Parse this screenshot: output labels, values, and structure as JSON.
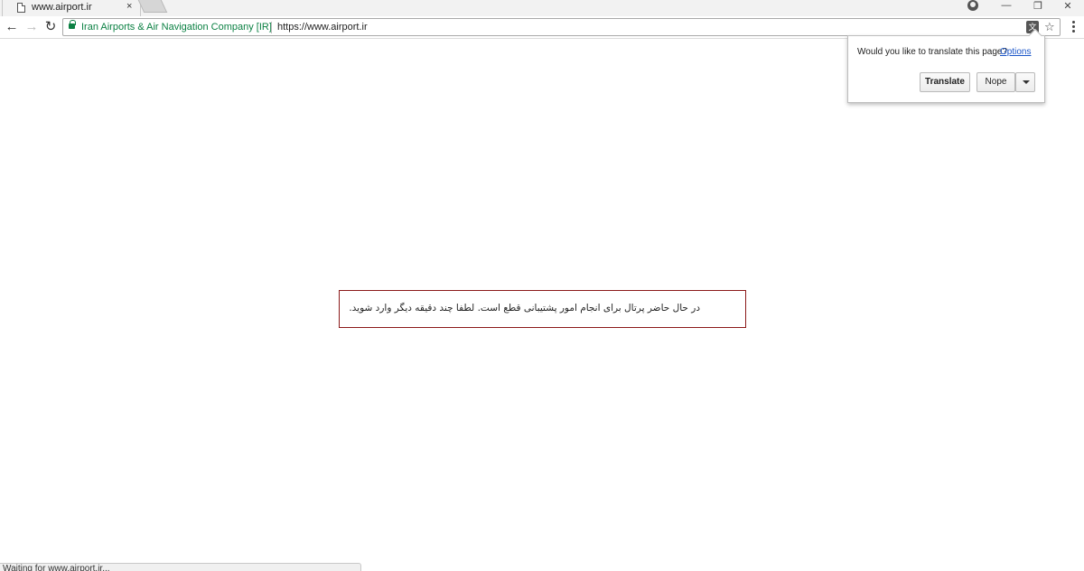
{
  "tab": {
    "title": "www.airport.ir",
    "close_glyph": "×",
    "page_icon": "page-icon"
  },
  "window_controls": {
    "minimize": "—",
    "restore": "❐",
    "close": "✕",
    "profile_icon": "profile-icon"
  },
  "toolbar": {
    "back_glyph": "←",
    "forward_glyph": "→",
    "reload_glyph": "↻",
    "cert_name": "Iran Airports & Air Navigation Company [IR]",
    "url": "https://www.airport.ir",
    "translate_glyph": "文",
    "star_glyph": "☆"
  },
  "translate_bubble": {
    "question": "Would you like to translate this page?",
    "options_link": "Options",
    "translate_button": "Translate",
    "nope_button": "Nope"
  },
  "content": {
    "message": "در حال حاضر پرتال برای انجام امور پشتیبانی قطع است. لطفا چند دقیقه دیگر وارد شوید."
  },
  "status_bar": {
    "text": "Waiting for www.airport.ir..."
  },
  "colors": {
    "secure_green": "#0b8043",
    "link_blue": "#1a55c8",
    "message_border": "#8b1a1a"
  }
}
